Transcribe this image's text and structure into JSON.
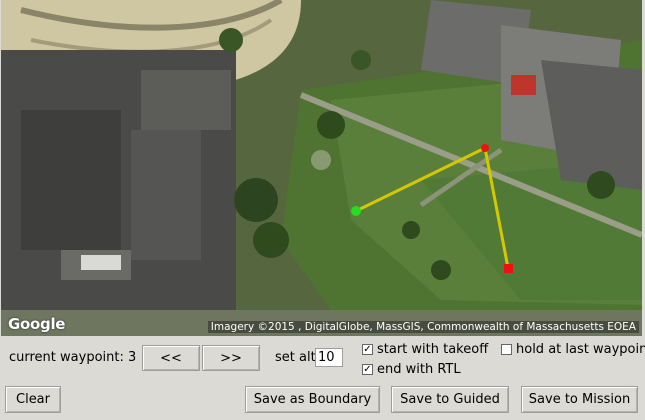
{
  "map": {
    "logo": "Google",
    "attribution": "Imagery ©2015 , DigitalGlobe, MassGIS, Commonwealth of Massachusetts EOEA",
    "route_color": "#d4c800",
    "start_marker_color": "#22dd22",
    "end_marker_color": "#ee1111"
  },
  "controls": {
    "current_waypoint_label": "current waypoint: 3",
    "prev_label": "<<",
    "next_label": ">>",
    "set_alt_label": "set alt",
    "alt_value": "10",
    "start_with_takeoff": {
      "label": "start with takeoff",
      "checked": true
    },
    "hold_at_last": {
      "label": "hold at last waypoint",
      "checked": false
    },
    "end_with_rtl": {
      "label": "end with RTL",
      "checked": true
    }
  },
  "buttons": {
    "clear": "Clear",
    "save_boundary": "Save as Boundary",
    "save_guided": "Save to Guided",
    "save_mission": "Save to Mission"
  }
}
